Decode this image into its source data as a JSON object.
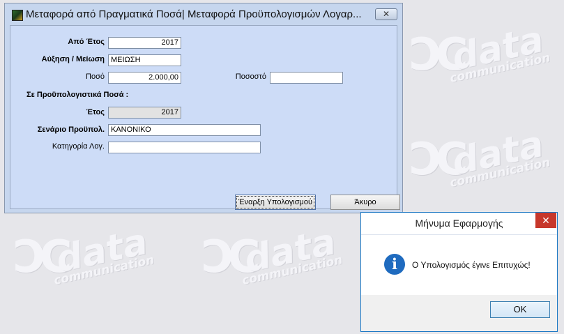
{
  "background": {
    "watermark_word": "data",
    "watermark_sub": "communication"
  },
  "dialog": {
    "title": "Μεταφορά από Πραγματικά Ποσά| Μεταφορά Προϋπολογισμών Λογαρ...",
    "close_glyph": "✕",
    "fields": {
      "from_year_label": "Από Έτος",
      "from_year_value": "2017",
      "change_label": "Αύξηση / Μείωση",
      "change_value": "ΜΕΙΩΣΗ",
      "amount_label": "Ποσό",
      "amount_value": "2.000,00",
      "percent_label": "Ποσοστό",
      "percent_value": "",
      "section_label": "Σε Προϋπολογιστικά Ποσά :",
      "year_label": "Έτος",
      "year_value": "2017",
      "scenario_label": "Σενάριο Προϋπολ.",
      "scenario_value": "ΚΑΝΟΝΙΚΟ",
      "category_label": "Κατηγορία Λογ.",
      "category_value": ""
    },
    "buttons": {
      "start": "Έναρξη Υπολογισμού",
      "cancel": "Άκυρο"
    }
  },
  "message_box": {
    "title": "Μήνυμα Εφαρμογής",
    "close_glyph": "✕",
    "icon": "info-icon",
    "icon_glyph": "i",
    "text": "Ο Υπολογισμός έγινε Επιτυχώς!",
    "ok": "OK"
  }
}
